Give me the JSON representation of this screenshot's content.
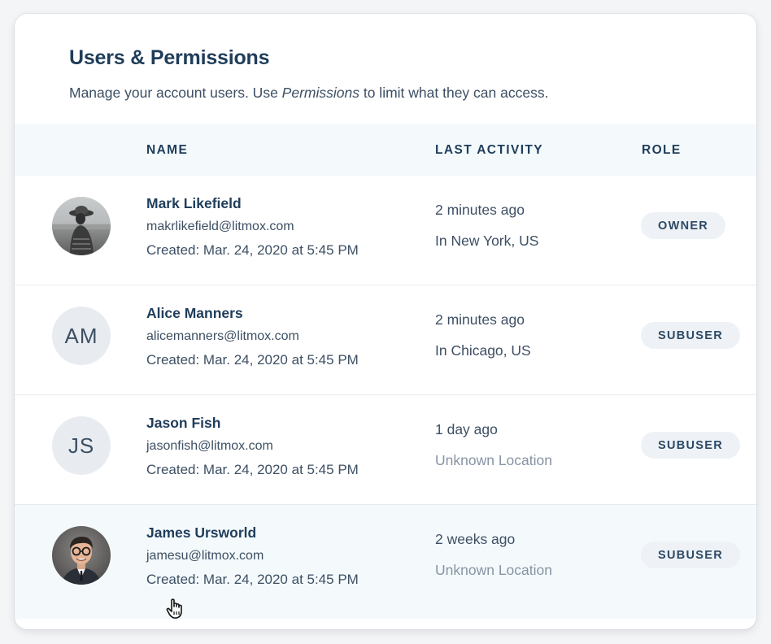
{
  "header": {
    "title": "Users & Permissions",
    "subtitle_before": "Manage your account users. Use ",
    "subtitle_emphasis": "Permissions",
    "subtitle_after": " to limit what they can access."
  },
  "table": {
    "columns": {
      "name": "NAME",
      "last_activity": "LAST ACTIVITY",
      "role": "ROLE"
    },
    "rows": [
      {
        "avatar": "photo-avatar-hat",
        "initials": "",
        "name": "Mark Likefield",
        "email": "makrlikefield@litmox.com",
        "created": "Created: Mar. 24, 2020 at 5:45 PM",
        "activity_time": "2 minutes ago",
        "activity_location": "In New York, US",
        "location_known": true,
        "role": "OWNER"
      },
      {
        "avatar": "initials",
        "initials": "AM",
        "name": "Alice Manners",
        "email": "alicemanners@litmox.com",
        "created": "Created: Mar. 24, 2020 at 5:45 PM",
        "activity_time": "2 minutes ago",
        "activity_location": "In Chicago, US",
        "location_known": true,
        "role": "SUBUSER"
      },
      {
        "avatar": "initials",
        "initials": "JS",
        "name": "Jason Fish",
        "email": "jasonfish@litmox.com",
        "created": "Created: Mar. 24, 2020 at 5:45 PM",
        "activity_time": "1 day ago",
        "activity_location": "Unknown Location",
        "location_known": false,
        "role": "SUBUSER"
      },
      {
        "avatar": "photo-avatar-glasses",
        "initials": "",
        "name": "James Ursworld",
        "email": "jamesu@litmox.com",
        "created": "Created: Mar. 24, 2020 at 5:45 PM",
        "activity_time": "2 weeks ago",
        "activity_location": "Unknown Location",
        "location_known": false,
        "role": "SUBUSER",
        "hovered": true
      }
    ]
  },
  "colors": {
    "heading": "#1f3d5a",
    "body_text": "#3d4f63",
    "muted_text": "#8794a4",
    "header_row_bg": "#f4fafc",
    "badge_bg": "#eef1f5",
    "avatar_bg": "#e8ecf1"
  },
  "cursor": "hand-pointer-icon"
}
